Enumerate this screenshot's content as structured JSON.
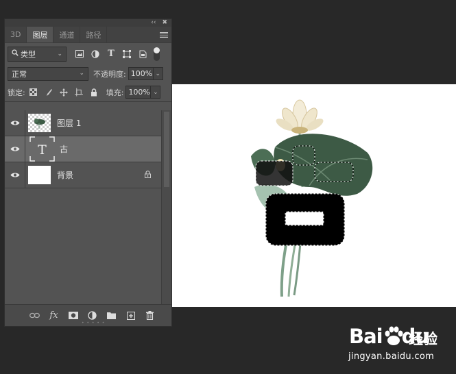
{
  "panel": {
    "topbar": {
      "collapse_glyph": "‹‹",
      "close_glyph": "✖"
    },
    "tabs": [
      {
        "label": "3D",
        "active": false
      },
      {
        "label": "图层",
        "active": true
      },
      {
        "label": "通道",
        "active": false
      },
      {
        "label": "路径",
        "active": false
      }
    ],
    "filter": {
      "label": "类型",
      "icons": [
        "image-filter-icon",
        "adjustment-filter-icon",
        "text-filter-icon",
        "shape-filter-icon",
        "smart-object-filter-icon"
      ]
    },
    "blend": {
      "mode": "正常",
      "opacity_label": "不透明度:",
      "opacity_value": "100%"
    },
    "lock": {
      "label": "锁定:",
      "fill_label": "填充:",
      "fill_value": "100%"
    },
    "layers": [
      {
        "name": "图层 1",
        "type": "pixel",
        "visible": true,
        "selected": false,
        "locked": false
      },
      {
        "name": "古",
        "type": "text",
        "visible": true,
        "selected": true,
        "locked": false
      },
      {
        "name": "背景",
        "type": "background",
        "visible": true,
        "selected": false,
        "locked": true
      }
    ],
    "bottom_icons": [
      "link-layers-icon",
      "fx-icon",
      "layer-mask-icon",
      "adjustment-layer-icon",
      "new-group-icon",
      "new-layer-icon",
      "delete-layer-icon"
    ],
    "fx_label": "fx"
  },
  "watermark": {
    "brand": "Bai",
    "brand2": "du",
    "cn": "经验",
    "url": "jingyan.baidu.com"
  },
  "colors": {
    "app_bg": "#282828",
    "panel_bg": "#535353",
    "selected_layer": "#6a6a6a",
    "canvas": "#ffffff",
    "leaf": "#3d5a45"
  }
}
